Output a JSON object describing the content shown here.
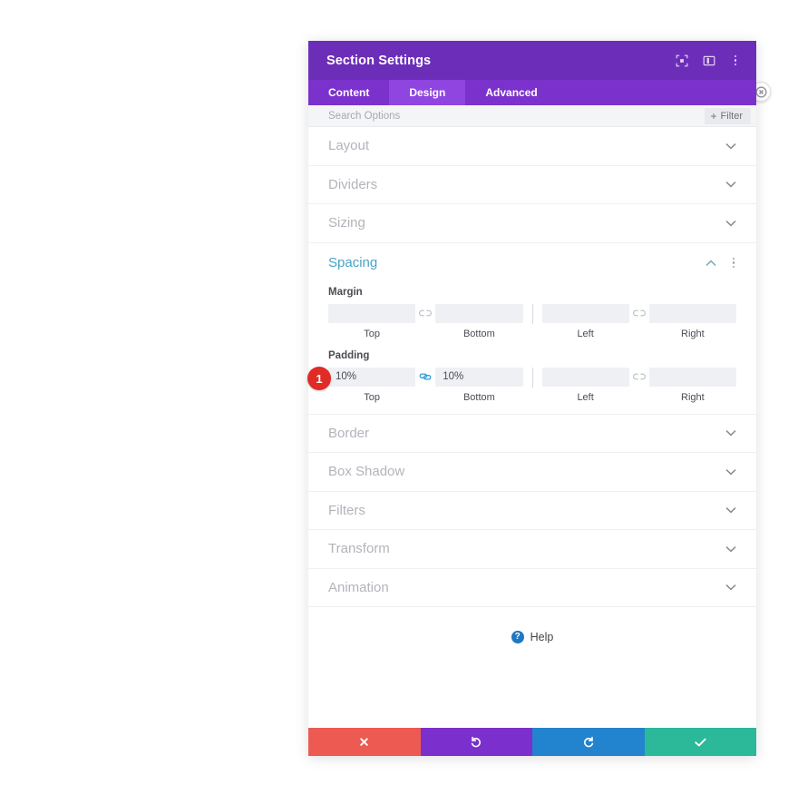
{
  "panel": {
    "title": "Section Settings",
    "header_icons": [
      {
        "name": "fullscreen-icon",
        "glyph": "fullscreen"
      },
      {
        "name": "layout-toggle-icon",
        "glyph": "panel-layout"
      },
      {
        "name": "more-options-icon",
        "glyph": "dots-vertical"
      }
    ],
    "edge_close_icon": "close-circle-icon"
  },
  "tabs": [
    {
      "label": "Content",
      "active": false
    },
    {
      "label": "Design",
      "active": true
    },
    {
      "label": "Advanced",
      "active": false
    }
  ],
  "search": {
    "placeholder": "Search Options",
    "value": "",
    "filter_label": "Filter",
    "filter_plus": "+"
  },
  "sections_above": [
    {
      "label": "Layout"
    },
    {
      "label": "Dividers"
    },
    {
      "label": "Sizing"
    }
  ],
  "spacing": {
    "title": "Spacing",
    "collapse_icon": "chevron-up-icon",
    "menu_icon": "dots-vertical-icon",
    "groups": [
      {
        "label": "Margin",
        "left_pair": {
          "link_state": "unlinked",
          "fields": [
            {
              "caption": "Top",
              "value": "",
              "placeholder": ""
            },
            {
              "caption": "Bottom",
              "value": "",
              "placeholder": ""
            }
          ]
        },
        "right_pair": {
          "link_state": "unlinked",
          "fields": [
            {
              "caption": "Left",
              "value": "",
              "placeholder": ""
            },
            {
              "caption": "Right",
              "value": "",
              "placeholder": ""
            }
          ]
        }
      },
      {
        "label": "Padding",
        "left_pair": {
          "link_state": "linked",
          "fields": [
            {
              "caption": "Top",
              "value": "10%",
              "placeholder": ""
            },
            {
              "caption": "Bottom",
              "value": "10%",
              "placeholder": ""
            }
          ]
        },
        "right_pair": {
          "link_state": "unlinked",
          "fields": [
            {
              "caption": "Left",
              "value": "",
              "placeholder": ""
            },
            {
              "caption": "Right",
              "value": "",
              "placeholder": ""
            }
          ]
        }
      }
    ]
  },
  "sections_below": [
    {
      "label": "Border"
    },
    {
      "label": "Box Shadow"
    },
    {
      "label": "Filters"
    },
    {
      "label": "Transform"
    },
    {
      "label": "Animation"
    }
  ],
  "help": {
    "label": "Help",
    "icon_glyph": "?"
  },
  "footer_actions": [
    {
      "name": "cancel-button",
      "icon": "close-icon",
      "color": "#ec5a52"
    },
    {
      "name": "undo-button",
      "icon": "undo-icon",
      "color": "#7b2fcc"
    },
    {
      "name": "redo-button",
      "icon": "redo-icon",
      "color": "#2283ce"
    },
    {
      "name": "save-button",
      "icon": "check-icon",
      "color": "#2bb99a"
    }
  ],
  "annotation_marker": {
    "number": "1"
  },
  "colors": {
    "header_purple": "#6c2eb9",
    "tabbar_purple": "#7b32cc",
    "tab_active_purple": "#8f45e0",
    "section_title_blue": "#4aa3c7",
    "link_active_blue": "#2d9cdb",
    "marker_red": "#e02b26",
    "field_bg": "#eef0f4"
  }
}
